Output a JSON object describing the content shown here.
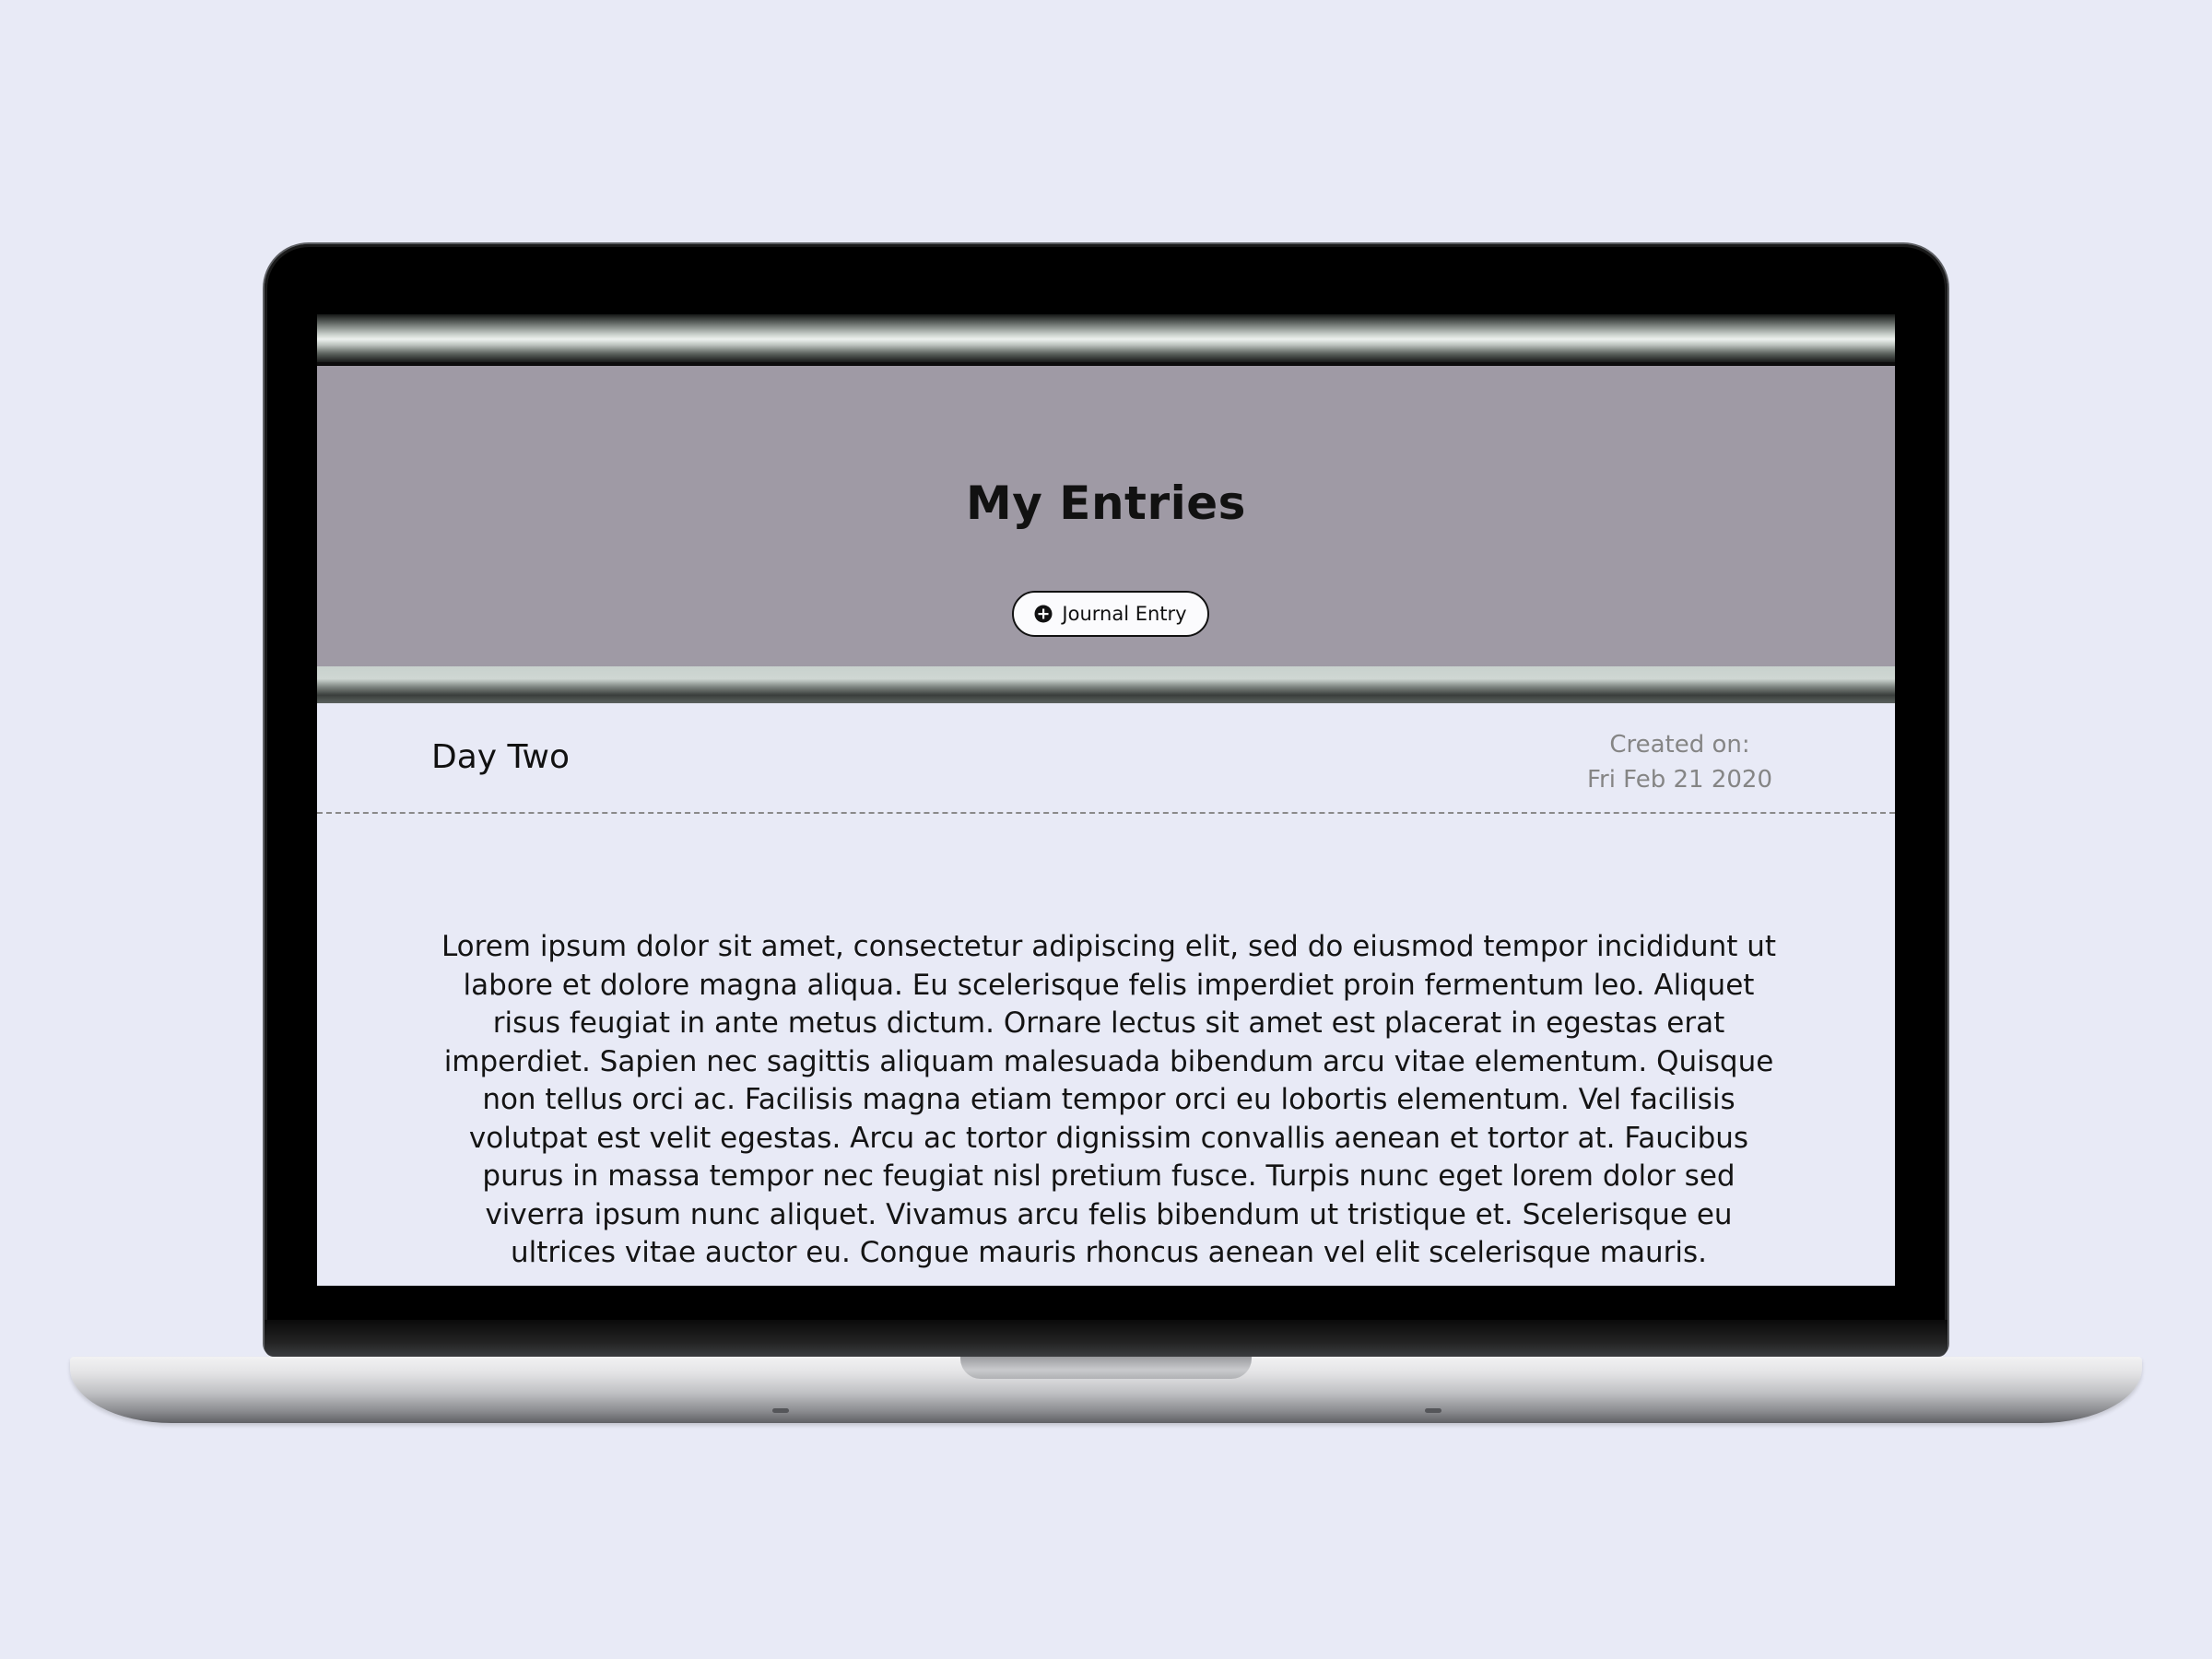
{
  "header": {
    "title": "My Entries",
    "add_button_label": "Journal Entry",
    "add_icon": "plus-circle-icon"
  },
  "entry": {
    "title": "Day Two",
    "created_label": "Created on:",
    "created_date": "Fri Feb 21 2020",
    "body": "Lorem ipsum dolor sit amet, consectetur adipiscing elit, sed do eiusmod tempor incididunt ut labore et dolore magna aliqua. Eu scelerisque felis imperdiet proin fermentum leo. Aliquet risus feugiat in ante metus dictum. Ornare lectus sit amet est placerat in egestas erat imperdiet. Sapien nec sagittis aliquam malesuada bibendum arcu vitae elementum. Quisque non tellus orci ac. Facilisis magna etiam tempor orci eu lobortis elementum. Vel facilisis volutpat est velit egestas. Arcu ac tortor dignissim convallis aenean et tortor at. Faucibus purus in massa tempor nec feugiat nisl pretium fusce. Turpis nunc eget lorem dolor sed viverra ipsum nunc aliquet. Vivamus arcu felis bibendum ut tristique et. Scelerisque eu ultrices vitae auctor eu. Congue mauris rhoncus aenean vel elit scelerisque mauris."
  },
  "colors": {
    "page_background": "#e8eaf6",
    "hero_background": "#9f9aa5",
    "text": "#111111",
    "muted_text": "#858585"
  }
}
